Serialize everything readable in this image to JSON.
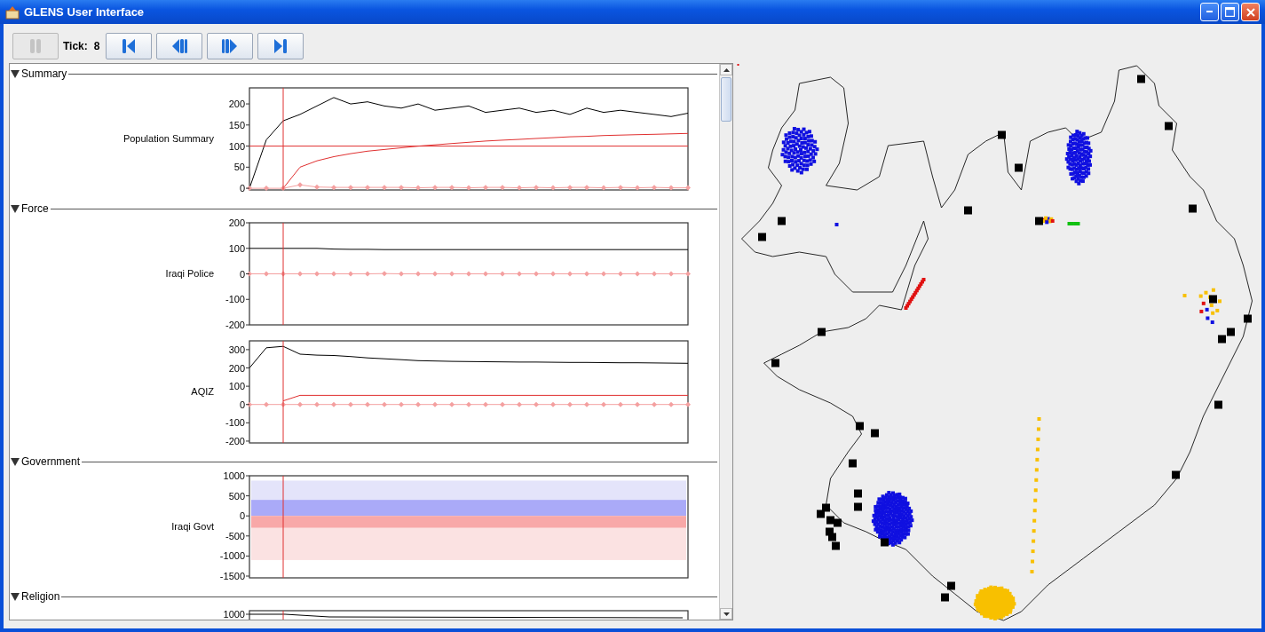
{
  "window": {
    "title": "GLENS User Interface"
  },
  "toolbar": {
    "buttons": [
      {
        "kind": "pause",
        "disabled": true
      }
    ],
    "tick_label": "Tick:",
    "tick_value": "8",
    "nav_buttons": [
      {
        "kind": "first",
        "disabled": false
      },
      {
        "kind": "back",
        "disabled": false
      },
      {
        "kind": "forward",
        "disabled": false
      },
      {
        "kind": "last",
        "disabled": false
      }
    ]
  },
  "sections": [
    {
      "title": "Summary",
      "expanded": true,
      "charts": [
        {
          "label": "Population Summary",
          "chart_data": {
            "type": "line",
            "categories": [
              null,
              null,
              null,
              null,
              null,
              null,
              null,
              null,
              null,
              null,
              null,
              null,
              null,
              null,
              null,
              null,
              null,
              null,
              null,
              null,
              null,
              null,
              null,
              null,
              null,
              null,
              null
            ],
            "ylim": [
              -4,
              238
            ],
            "yticks": [
              0,
              50,
              100,
              150,
              200
            ],
            "series": [
              {
                "color": "#000000",
                "values": [
                  0,
                  115,
                  160,
                  175,
                  195,
                  215,
                  200,
                  205,
                  195,
                  190,
                  200,
                  185,
                  190,
                  195,
                  180,
                  185,
                  190,
                  180,
                  185,
                  175,
                  190,
                  180,
                  185,
                  180,
                  175,
                  170,
                  178
                ]
              },
              {
                "color": "#e03030",
                "values": [
                  100,
                  100,
                  100,
                  100,
                  100,
                  100,
                  100,
                  100,
                  100,
                  100,
                  100,
                  100,
                  100,
                  100,
                  100,
                  100,
                  100,
                  100,
                  100,
                  100,
                  100,
                  100,
                  100,
                  100,
                  100,
                  100,
                  100
                ]
              },
              {
                "color": "#e03030",
                "values": [
                  null,
                  null,
                  0,
                  50,
                  65,
                  75,
                  82,
                  88,
                  92,
                  96,
                  100,
                  103,
                  106,
                  109,
                  112,
                  114,
                  116,
                  118,
                  120,
                  122,
                  123,
                  125,
                  126,
                  127,
                  128,
                  129,
                  130
                ]
              },
              {
                "color": "#f4a0a0",
                "marker": "diamond",
                "values": [
                  0,
                  0,
                  0,
                  8,
                  3,
                  2,
                  2,
                  2,
                  2,
                  2,
                  1,
                  2,
                  2,
                  1,
                  2,
                  2,
                  1,
                  2,
                  1,
                  2,
                  2,
                  1,
                  2,
                  1,
                  2,
                  1,
                  1
                ]
              }
            ]
          }
        }
      ]
    },
    {
      "title": "Force",
      "expanded": true,
      "charts": [
        {
          "label": "Iraqi Police",
          "chart_data": {
            "type": "line",
            "categories": [
              null,
              null,
              null,
              null,
              null,
              null,
              null,
              null,
              null,
              null,
              null,
              null,
              null,
              null,
              null,
              null,
              null,
              null,
              null,
              null,
              null,
              null,
              null,
              null,
              null,
              null,
              null
            ],
            "ylim": [
              -200,
              200
            ],
            "yticks": [
              -200,
              -100,
              0,
              100,
              200
            ],
            "series": [
              {
                "color": "#000000",
                "values": [
                  100,
                  100,
                  100,
                  100,
                  100,
                  97,
                  96,
                  96,
                  95,
                  95,
                  95,
                  95,
                  95,
                  95,
                  95,
                  95,
                  95,
                  95,
                  95,
                  95,
                  95,
                  95,
                  95,
                  95,
                  95,
                  95,
                  95
                ]
              },
              {
                "color": "#f4a0a0",
                "marker": "diamond",
                "values": [
                  0,
                  0,
                  0,
                  0,
                  0,
                  0,
                  0,
                  0,
                  1,
                  0,
                  0,
                  0,
                  0,
                  0,
                  0,
                  0,
                  0,
                  0,
                  0,
                  0,
                  0,
                  0,
                  0,
                  0,
                  0,
                  0,
                  0
                ]
              }
            ]
          }
        },
        {
          "label": "AQIZ",
          "chart_data": {
            "type": "line",
            "categories": [
              null,
              null,
              null,
              null,
              null,
              null,
              null,
              null,
              null,
              null,
              null,
              null,
              null,
              null,
              null,
              null,
              null,
              null,
              null,
              null,
              null,
              null,
              null,
              null,
              null,
              null,
              null
            ],
            "ylim": [
              -210,
              348
            ],
            "yticks": [
              -200,
              -100,
              0,
              100,
              200,
              300
            ],
            "series": [
              {
                "color": "#000000",
                "values": [
                  200,
                  310,
                  318,
                  275,
                  270,
                  268,
                  262,
                  255,
                  250,
                  245,
                  240,
                  238,
                  236,
                  235,
                  234,
                  233,
                  232,
                  232,
                  231,
                  230,
                  230,
                  229,
                  228,
                  228,
                  227,
                  226,
                  225
                ]
              },
              {
                "color": "#e03030",
                "values": [
                  null,
                  null,
                  20,
                  50,
                  50,
                  50,
                  50,
                  50,
                  50,
                  50,
                  50,
                  50,
                  50,
                  50,
                  50,
                  50,
                  50,
                  50,
                  50,
                  50,
                  50,
                  50,
                  50,
                  50,
                  50,
                  50,
                  50
                ]
              },
              {
                "color": "#f4a0a0",
                "marker": "diamond",
                "values": [
                  0,
                  0,
                  0,
                  0,
                  0,
                  0,
                  0,
                  0,
                  0,
                  0,
                  0,
                  0,
                  0,
                  0,
                  0,
                  0,
                  0,
                  0,
                  0,
                  0,
                  0,
                  0,
                  0,
                  0,
                  0,
                  0,
                  0
                ]
              }
            ]
          }
        }
      ]
    },
    {
      "title": "Government",
      "expanded": true,
      "charts": [
        {
          "label": "Iraqi Govt",
          "axis_ticks": [
            "1000",
            "500",
            "0",
            "-500",
            "-1000",
            "-1500"
          ]
        }
      ]
    },
    {
      "title": "Religion",
      "expanded": true,
      "charts": [
        {
          "top_tick": "1000"
        }
      ]
    }
  ]
}
